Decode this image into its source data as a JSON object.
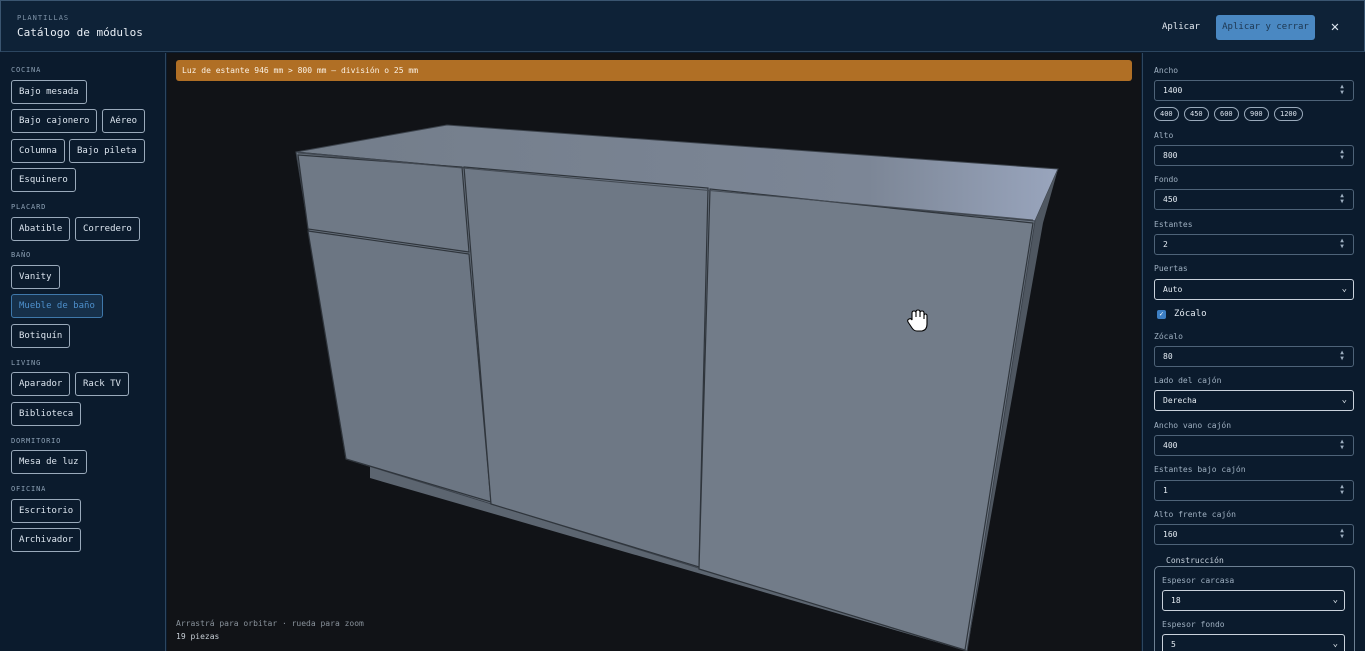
{
  "header": {
    "eyebrow": "PLANTILLAS",
    "title": "Catálogo de módulos",
    "apply_label": "Aplicar",
    "apply_close_label": "Aplicar y cerrar",
    "close_icon": "✕"
  },
  "sidebar": {
    "categories": [
      {
        "label": "COCINA",
        "items": [
          "Bajo mesada",
          "Bajo cajonero",
          "Aéreo",
          "Columna",
          "Bajo pileta",
          "Esquinero"
        ]
      },
      {
        "label": "PLACARD",
        "items": [
          "Abatible",
          "Corredero"
        ]
      },
      {
        "label": "BAÑO",
        "items": [
          "Vanity",
          "Mueble de baño",
          "Botiquín"
        ]
      },
      {
        "label": "LIVING",
        "items": [
          "Aparador",
          "Rack TV",
          "Biblioteca"
        ]
      },
      {
        "label": "DORMITORIO",
        "items": [
          "Mesa de luz"
        ]
      },
      {
        "label": "OFICINA",
        "items": [
          "Escritorio",
          "Archivador"
        ]
      }
    ],
    "active_item": "Mueble de baño"
  },
  "viewport": {
    "warning": "Luz de estante 946 mm > 800 mm — división o 25 mm",
    "hint": "Arrastrá para orbitar · rueda para zoom",
    "piece_count": "19 piezas",
    "cursor_icon": "grab-hand"
  },
  "panel": {
    "ancho": {
      "label": "Ancho",
      "value": "1400",
      "presets": [
        "400",
        "450",
        "600",
        "900",
        "1200"
      ]
    },
    "alto": {
      "label": "Alto",
      "value": "800"
    },
    "fondo": {
      "label": "Fondo",
      "value": "450"
    },
    "estantes": {
      "label": "Estantes",
      "value": "2"
    },
    "puertas": {
      "label": "Puertas",
      "value": "Auto"
    },
    "zocalo_toggle": {
      "label": "Zócalo",
      "checked": true
    },
    "zocalo": {
      "label": "Zócalo",
      "value": "80"
    },
    "lado_cajon": {
      "label": "Lado del cajón",
      "value": "Derecha"
    },
    "ancho_vano": {
      "label": "Ancho vano cajón",
      "value": "400"
    },
    "estantes_bajo": {
      "label": "Estantes bajo cajón",
      "value": "1"
    },
    "alto_frente": {
      "label": "Alto frente cajón",
      "value": "160"
    },
    "construccion": {
      "legend": "Construcción",
      "espesor_carcasa": {
        "label": "Espesor carcasa",
        "value": "18"
      },
      "espesor_fondo": {
        "label": "Espesor fondo",
        "value": "5"
      }
    }
  },
  "colors": {
    "background": "#0b1b2d",
    "accent": "#4a88c2",
    "warning": "#b06f25",
    "viewport": "#111317",
    "cabinet": "#6e7885"
  }
}
